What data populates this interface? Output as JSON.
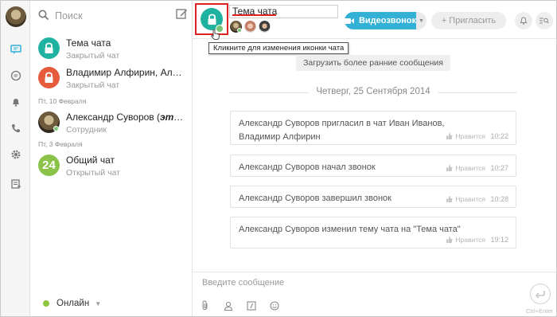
{
  "colors": {
    "accent": "#32b0d6",
    "teal": "#1fb2a0",
    "orange_red": "#e55b3c",
    "green": "#8bc34a",
    "highlight": "#e02020"
  },
  "rail": {
    "items": [
      {
        "icon": "chat-icon",
        "active": true
      },
      {
        "icon": "history-icon"
      },
      {
        "icon": "bell-icon"
      },
      {
        "icon": "phone-icon"
      },
      {
        "icon": "gear-icon"
      },
      {
        "icon": "contacts-icon"
      }
    ]
  },
  "search": {
    "placeholder": "Поиск",
    "edit_icon": "compose-icon"
  },
  "chats": [
    {
      "name": "Тема чата",
      "subtitle": "Закрытый чат",
      "avatar": "lock-teal"
    },
    {
      "name": "Владимир Алфирин, Алекс...",
      "subtitle": "Закрытый чат",
      "avatar": "lock-red"
    },
    {
      "date_header": "Пт, 10 Февраля"
    },
    {
      "name_prefix": "Александр Суворов (",
      "name_italic": "это в...",
      "subtitle": "Сотрудник",
      "avatar": "photo"
    },
    {
      "date_header": "Пт, 3 Февраля"
    },
    {
      "name": "Общий чат",
      "subtitle": "Открытый чат",
      "avatar_text": "24"
    }
  ],
  "status": {
    "label": "Онлайн"
  },
  "header": {
    "title_value": "Тема чата",
    "video_button": "Видеозвонок",
    "invite_button": "+ Пригласить",
    "tooltip": "Кликните для изменения иконки чата"
  },
  "messages_area": {
    "load_more": "Загрузить более ранние сообщения",
    "day": "Четверг, 25 Сентября 2014",
    "messages": [
      {
        "text": "Александр Суворов пригласил в чат Иван Иванов, Владимир Алфирин",
        "like": "Нравится",
        "time": "10:22"
      },
      {
        "text": "Александр Суворов начал звонок",
        "like": "Нравится",
        "time": "10:27"
      },
      {
        "text": "Александр Суворов завершил звонок",
        "like": "Нравится",
        "time": "10:28"
      },
      {
        "text": "Александр Суворов изменил тему чата на \"Тема чата\"",
        "like": "Нравится",
        "time": "19:12"
      }
    ]
  },
  "composer": {
    "placeholder": "Введите сообщение",
    "send_hint": "Ctrl+Enter"
  }
}
